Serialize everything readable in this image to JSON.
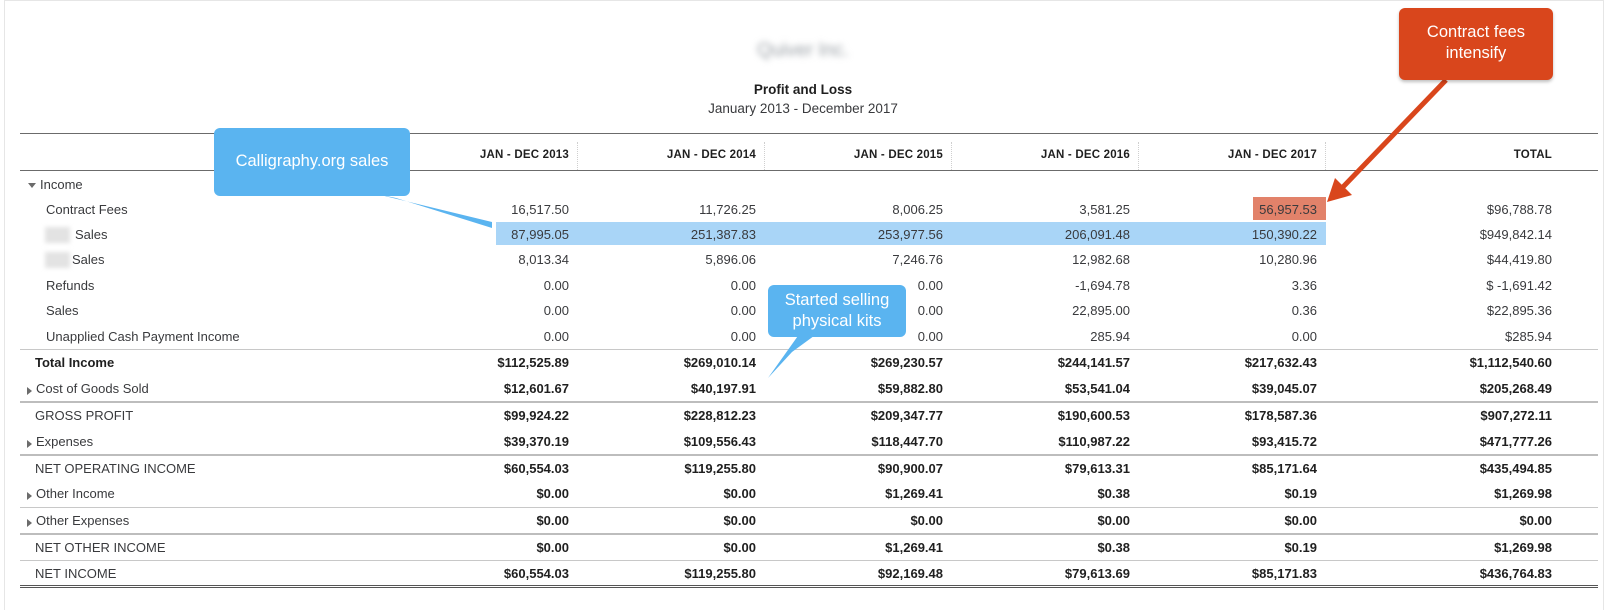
{
  "report": {
    "company": "Quiver Inc.",
    "title": "Profit and Loss",
    "period": "January 2013 - December 2017"
  },
  "columns": [
    "JAN - DEC 2013",
    "JAN - DEC 2014",
    "JAN - DEC 2015",
    "JAN - DEC 2016",
    "JAN - DEC 2017",
    "TOTAL"
  ],
  "income_group": {
    "label": "Income",
    "icon": "caret-down-icon"
  },
  "rows": [
    {
      "label": "Contract Fees",
      "values": [
        "16,517.50",
        "11,726.25",
        "8,006.25",
        "3,581.25",
        "56,957.53",
        "$96,788.78"
      ]
    },
    {
      "label": "Sales",
      "values": [
        "87,995.05",
        "251,387.83",
        "253,977.56",
        "206,091.48",
        "150,390.22",
        "$949,842.14"
      ]
    },
    {
      "label": "Sales",
      "values": [
        "8,013.34",
        "5,896.06",
        "7,246.76",
        "12,982.68",
        "10,280.96",
        "$44,419.80"
      ]
    },
    {
      "label": "Refunds",
      "values": [
        "0.00",
        "0.00",
        "0.00",
        "-1,694.78",
        "3.36",
        "$ -1,691.42"
      ]
    },
    {
      "label": "Sales",
      "values": [
        "0.00",
        "0.00",
        "0.00",
        "22,895.00",
        "0.36",
        "$22,895.36"
      ]
    },
    {
      "label": "Unapplied Cash Payment Income",
      "values": [
        "0.00",
        "0.00",
        "0.00",
        "285.94",
        "0.00",
        "$285.94"
      ]
    },
    {
      "label": "Total Income",
      "values": [
        "$112,525.89",
        "$269,010.14",
        "$269,230.57",
        "$244,141.57",
        "$217,632.43",
        "$1,112,540.60"
      ]
    },
    {
      "label": "Cost of Goods Sold",
      "values": [
        "$12,601.67",
        "$40,197.91",
        "$59,882.80",
        "$53,541.04",
        "$39,045.07",
        "$205,268.49"
      ]
    },
    {
      "label": "GROSS PROFIT",
      "values": [
        "$99,924.22",
        "$228,812.23",
        "$209,347.77",
        "$190,600.53",
        "$178,587.36",
        "$907,272.11"
      ]
    },
    {
      "label": "Expenses",
      "values": [
        "$39,370.19",
        "$109,556.43",
        "$118,447.70",
        "$110,987.22",
        "$93,415.72",
        "$471,777.26"
      ]
    },
    {
      "label": "NET OPERATING INCOME",
      "values": [
        "$60,554.03",
        "$119,255.80",
        "$90,900.07",
        "$79,613.31",
        "$85,171.64",
        "$435,494.85"
      ]
    },
    {
      "label": "Other Income",
      "values": [
        "$0.00",
        "$0.00",
        "$1,269.41",
        "$0.38",
        "$0.19",
        "$1,269.98"
      ]
    },
    {
      "label": "Other Expenses",
      "values": [
        "$0.00",
        "$0.00",
        "$0.00",
        "$0.00",
        "$0.00",
        "$0.00"
      ]
    },
    {
      "label": "NET OTHER INCOME",
      "values": [
        "$0.00",
        "$0.00",
        "$1,269.41",
        "$0.38",
        "$0.19",
        "$1,269.98"
      ]
    },
    {
      "label": "NET INCOME",
      "values": [
        "$60,554.03",
        "$119,255.80",
        "$92,169.48",
        "$79,613.69",
        "$85,171.83",
        "$436,764.83"
      ]
    }
  ],
  "annotations": {
    "calligraphy": "Calligraphy.org sales",
    "physical_kits_line1": "Started selling",
    "physical_kits_line2": "physical kits",
    "contract_fees_line1": "Contract fees",
    "contract_fees_line2": "intensify"
  },
  "colors": {
    "highlight_blue": "#a9d5f7",
    "highlight_orange": "#e2826a",
    "callout_blue": "#5ab4f0",
    "callout_orange": "#d9461c"
  }
}
